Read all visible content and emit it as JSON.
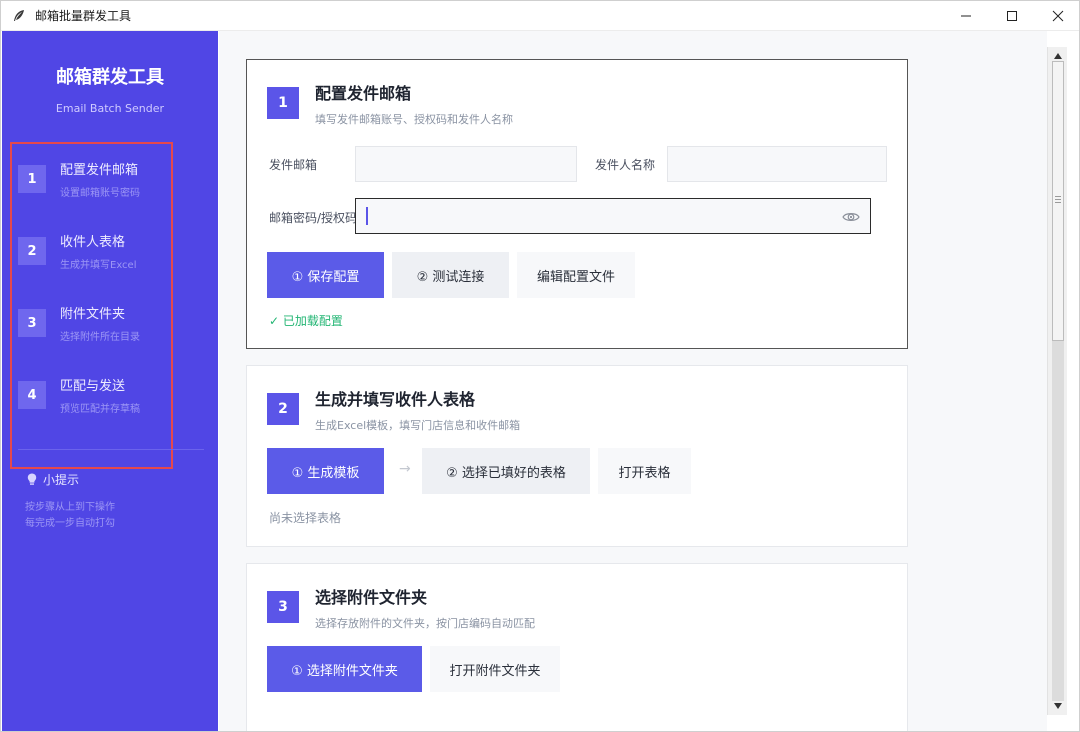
{
  "window": {
    "title": "邮箱批量群发工具",
    "controls": [
      "minimize",
      "maximize",
      "close"
    ]
  },
  "sidebar": {
    "brand_title": "邮箱群发工具",
    "brand_subtitle": "Email Batch Sender",
    "steps": [
      {
        "num": "1",
        "title": "配置发件邮箱",
        "desc": "设置邮箱账号密码"
      },
      {
        "num": "2",
        "title": "收件人表格",
        "desc": "生成并填写Excel"
      },
      {
        "num": "3",
        "title": "附件文件夹",
        "desc": "选择附件所在目录"
      },
      {
        "num": "4",
        "title": "匹配与发送",
        "desc": "预览匹配并存草稿"
      }
    ],
    "tip": {
      "title": "小提示",
      "lines": [
        "按步骤从上到下操作",
        "每完成一步自动打勾"
      ]
    }
  },
  "cards": [
    {
      "num": "1",
      "title": "配置发件邮箱",
      "desc": "填写发件邮箱账号、授权码和发件人名称",
      "fields": {
        "email_label": "发件邮箱",
        "email_value": "",
        "name_label": "发件人名称",
        "name_value": "",
        "password_label": "邮箱密码/授权码",
        "password_value": ""
      },
      "buttons": {
        "save": "① 保存配置",
        "test": "② 测试连接",
        "edit": "编辑配置文件"
      },
      "status": "✓ 已加载配置"
    },
    {
      "num": "2",
      "title": "生成并填写收件人表格",
      "desc": "生成Excel模板，填写门店信息和收件邮箱",
      "buttons": {
        "generate": "① 生成模板",
        "arrow": "→",
        "select": "② 选择已填好的表格",
        "open": "打开表格"
      },
      "status": "尚未选择表格"
    },
    {
      "num": "3",
      "title": "选择附件文件夹",
      "desc": "选择存放附件的文件夹，按门店编码自动匹配",
      "buttons": {
        "select": "① 选择附件文件夹",
        "open": "打开附件文件夹"
      }
    }
  ],
  "colors": {
    "sidebar_bg": "#5046e5",
    "primary": "#5b5be8",
    "success": "#22b573",
    "highlight_box": "#e5484d"
  },
  "icons": {
    "app": "feather-icon",
    "tip": "bulb-icon",
    "password_toggle": "eye-icon"
  }
}
